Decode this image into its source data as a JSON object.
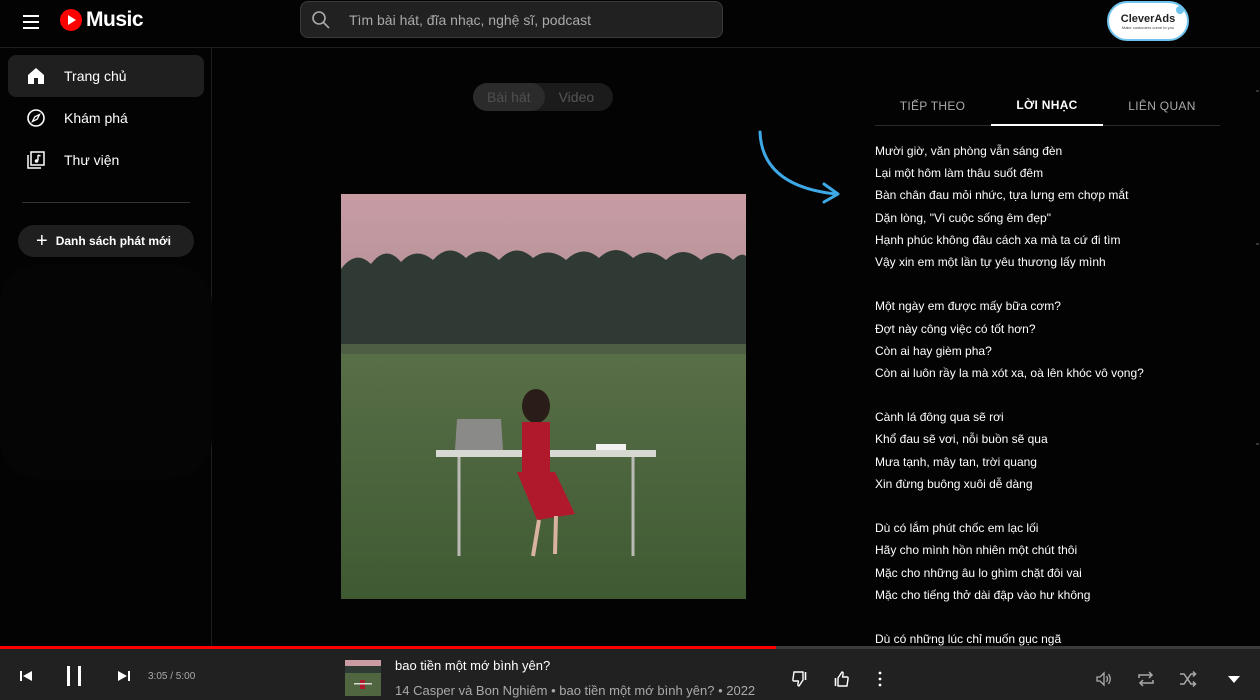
{
  "header": {
    "logo_text": "Music",
    "search_placeholder": "Tìm bài hát, đĩa nhạc, nghệ sĩ, podcast",
    "ad_badge_text": "CleverAds",
    "ad_badge_tagline": "Make customers come to you"
  },
  "sidebar": {
    "items": [
      {
        "label": "Trang chủ",
        "icon": "home-icon",
        "active": true
      },
      {
        "label": "Khám phá",
        "icon": "compass-icon",
        "active": false
      },
      {
        "label": "Thư viện",
        "icon": "library-icon",
        "active": false
      }
    ],
    "new_playlist_label": "Danh sách phát mới"
  },
  "main": {
    "switcher": {
      "song": "Bài hát",
      "video": "Video"
    }
  },
  "panel": {
    "tabs": [
      {
        "label": "TIẾP THEO",
        "active": false
      },
      {
        "label": "LỜI NHẠC",
        "active": true
      },
      {
        "label": "LIÊN QUAN",
        "active": false
      }
    ],
    "lyrics": [
      "Mười giờ, văn phòng vẫn sáng đèn",
      "Lại một hôm làm thâu suốt đêm",
      "Bàn chân đau mỏi nhức, tựa lưng em chợp mắt",
      "Dặn lòng, \"Vì cuộc sống êm đẹp\"",
      "Hạnh phúc không đâu cách xa mà ta cứ đi tìm",
      "Vậy xin em một lần tự yêu thương lấy mình",
      "",
      "Một ngày em được mấy bữa cơm?",
      "Đợt này công việc có tốt hơn?",
      "Còn ai hay gièm pha?",
      "Còn ai luôn rầy la mà xót xa, oà lên khóc vô vọng?",
      "",
      "Cành lá đông qua sẽ rơi",
      "Khổ đau sẽ vơi, nỗi buồn sẽ qua",
      "Mưa tạnh, mây tan, trời quang",
      "Xin đừng buông xuôi dễ dàng",
      "",
      "Dù có lắm phút chốc em lạc lối",
      "Hãy cho mình hồn nhiên một chút thôi",
      "Mặc cho những âu lo ghìm chặt đôi vai",
      "Mặc cho tiếng thở dài đập vào hư không",
      "",
      "Dù có những lúc chỉ muốn gục ngã"
    ]
  },
  "player": {
    "time_display": "3:05 / 5:00",
    "progress": 0.616,
    "song_title": "bao tiền một mớ bình yên?",
    "song_subtitle": "14 Casper và Bon Nghiêm • bao tiền một mớ bình yên? • 2022"
  },
  "colors": {
    "background": "#030303",
    "accent_red": "#ff0000",
    "arrow_blue": "#3fa9e8",
    "player_bar": "#212121"
  }
}
